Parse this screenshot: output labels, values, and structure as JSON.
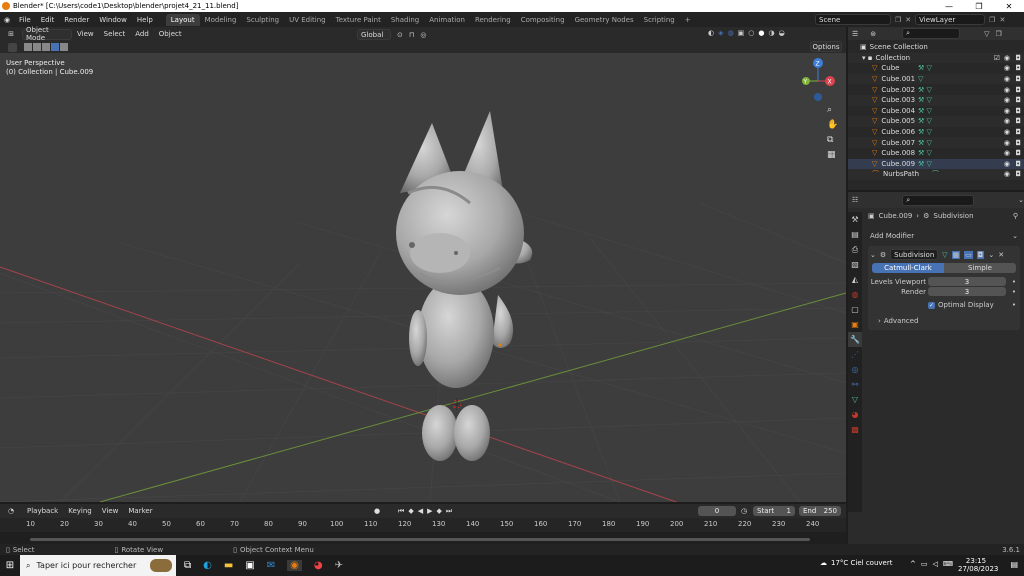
{
  "window": {
    "title": "Blender* [C:\\Users\\code1\\Desktop\\blender\\projet4_21_11.blend]",
    "minimize": "—",
    "maximize": "❐",
    "close": "✕"
  },
  "menu": [
    "File",
    "Edit",
    "Render",
    "Window",
    "Help"
  ],
  "workspaces": [
    "Layout",
    "Modeling",
    "Sculpting",
    "UV Editing",
    "Texture Paint",
    "Shading",
    "Animation",
    "Rendering",
    "Compositing",
    "Geometry Nodes",
    "Scripting"
  ],
  "active_workspace": "Layout",
  "scene": {
    "label": "Scene",
    "view_layer": "ViewLayer"
  },
  "viewport_header": {
    "mode": "Object Mode",
    "menus": [
      "View",
      "Select",
      "Add",
      "Object"
    ],
    "orientation": "Global",
    "options": "Options"
  },
  "viewport": {
    "perspective": "User Perspective",
    "collection": "(0) Collection | Cube.009",
    "gizmo": {
      "x": "X",
      "y": "Y",
      "z": "Z"
    }
  },
  "outliner": {
    "root": "Scene Collection",
    "collection": "Collection",
    "items": [
      "Cube",
      "Cube.001",
      "Cube.002",
      "Cube.003",
      "Cube.004",
      "Cube.005",
      "Cube.006",
      "Cube.007",
      "Cube.008",
      "Cube.009",
      "NurbsPath"
    ],
    "selected": "Cube.009"
  },
  "properties": {
    "object": "Cube.009",
    "modifier_crumb": "Subdivision",
    "add_modifier": "Add Modifier",
    "modifier_name": "Subdivision",
    "mode_catmull": "Catmull-Clark",
    "mode_simple": "Simple",
    "levels_viewport_label": "Levels Viewport",
    "levels_viewport": "3",
    "render_label": "Render",
    "render": "3",
    "optimal_display": "Optimal Display",
    "advanced": "Advanced"
  },
  "timeline": {
    "menus": [
      "Playback",
      "Keying",
      "View",
      "Marker"
    ],
    "current_frame": "0",
    "start_label": "Start",
    "start": "1",
    "end_label": "End",
    "end": "250",
    "ticks": [
      "10",
      "20",
      "30",
      "40",
      "50",
      "60",
      "70",
      "80",
      "90",
      "100",
      "110",
      "120",
      "130",
      "140",
      "150",
      "160",
      "170",
      "180",
      "190",
      "200",
      "210",
      "220",
      "230",
      "240"
    ]
  },
  "statusbar": {
    "select": "Select",
    "rotate": "Rotate View",
    "context": "Object Context Menu",
    "version": "3.6.1"
  },
  "taskbar": {
    "search": "Taper ici pour rechercher",
    "weather": "17°C  Ciel couvert",
    "time": "23:15",
    "date": "27/08/2023"
  },
  "colors": {
    "accent": "#4772b3",
    "orange": "#e87d0d",
    "mesh_green": "#4fc0a0",
    "x_axis": "#d9434e",
    "y_axis": "#7fb33a",
    "z_axis": "#3c7ed8"
  }
}
